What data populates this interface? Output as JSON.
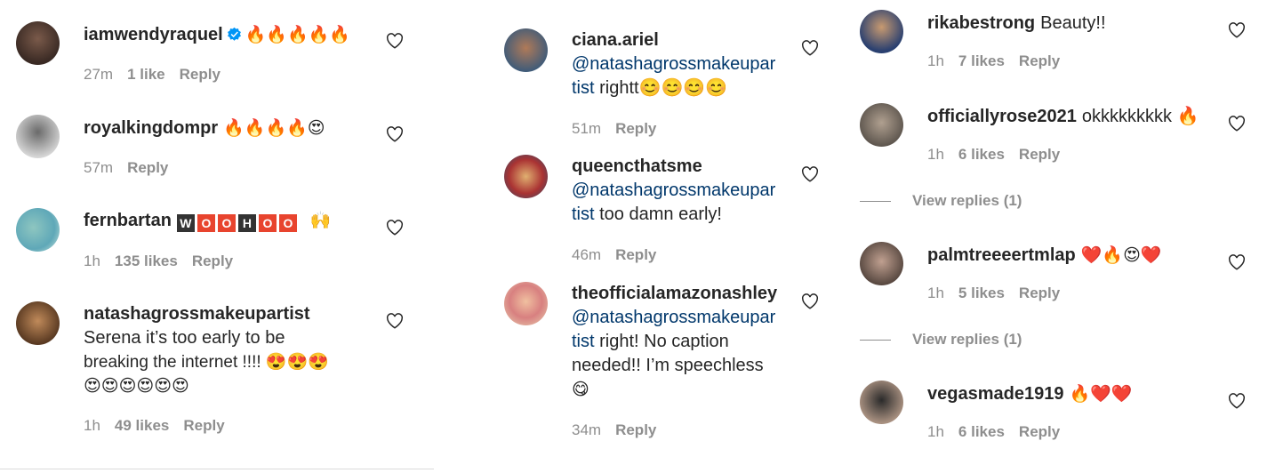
{
  "columns": [
    {
      "comments": [
        {
          "username": "iamwendyraquel",
          "verified": true,
          "text": "🔥🔥🔥🔥🔥",
          "time": "27m",
          "likes": "1 like",
          "reply": "Reply"
        },
        {
          "username": "royalkingdompr",
          "text": "🔥🔥🔥🔥😍",
          "time": "57m",
          "likes": "",
          "reply": "Reply"
        },
        {
          "username": "fernbartan",
          "text_tiles": [
            "W",
            "O",
            "O",
            "H",
            "O",
            "O"
          ],
          "text_after": "🙌",
          "time": "1h",
          "likes": "135 likes",
          "reply": "Reply"
        },
        {
          "username": "natashagrossmakeupartist",
          "text_lines": [
            "Serena it’s too early to be",
            "breaking the internet !!!! 😍😍😍",
            "😍😍😍😍😍😍"
          ],
          "time": "1h",
          "likes": "49 likes",
          "reply": "Reply"
        }
      ]
    },
    {
      "comments": [
        {
          "username": "ciana.ariel",
          "mention_lines": [
            "@natashagrossmakeupar",
            "tist"
          ],
          "text": "rightt😊😊😊😊",
          "time": "51m",
          "likes": "",
          "reply": "Reply"
        },
        {
          "username": "queencthatsme",
          "mention_lines": [
            "@natashagrossmakeupar",
            "tist"
          ],
          "text": "too damn early!",
          "time": "46m",
          "likes": "",
          "reply": "Reply"
        },
        {
          "username": "theofficialamazonashley",
          "mention_lines": [
            "@natashagrossmakeupar",
            "tist"
          ],
          "text": "right! No caption",
          "text_lines": [
            "needed!! I’m speechless",
            "😋"
          ],
          "time": "34m",
          "likes": "",
          "reply": "Reply"
        }
      ]
    },
    {
      "comments": [
        {
          "username": "rikabestrong",
          "text": "Beauty!!",
          "time": "1h",
          "likes": "7 likes",
          "reply": "Reply"
        },
        {
          "username": "officiallyrose2021",
          "text": "okkkkkkkkk 🔥",
          "time": "1h",
          "likes": "6 likes",
          "reply": "Reply",
          "view_replies": "View replies (1)"
        },
        {
          "username": "palmtreeeertmlap",
          "text": "❤️🔥😍❤️",
          "time": "1h",
          "likes": "5 likes",
          "reply": "Reply",
          "view_replies": "View replies (1)"
        },
        {
          "username": "vegasmade1919",
          "text": "🔥❤️❤️",
          "time": "1h",
          "likes": "6 likes",
          "reply": "Reply"
        }
      ]
    }
  ],
  "colors": {
    "text": "#262626",
    "meta": "#8e8e8e",
    "mention": "#00376b",
    "verified": "#0095f6"
  },
  "icons": {
    "like": "heart-outline-icon",
    "verified": "verified-badge-icon"
  }
}
